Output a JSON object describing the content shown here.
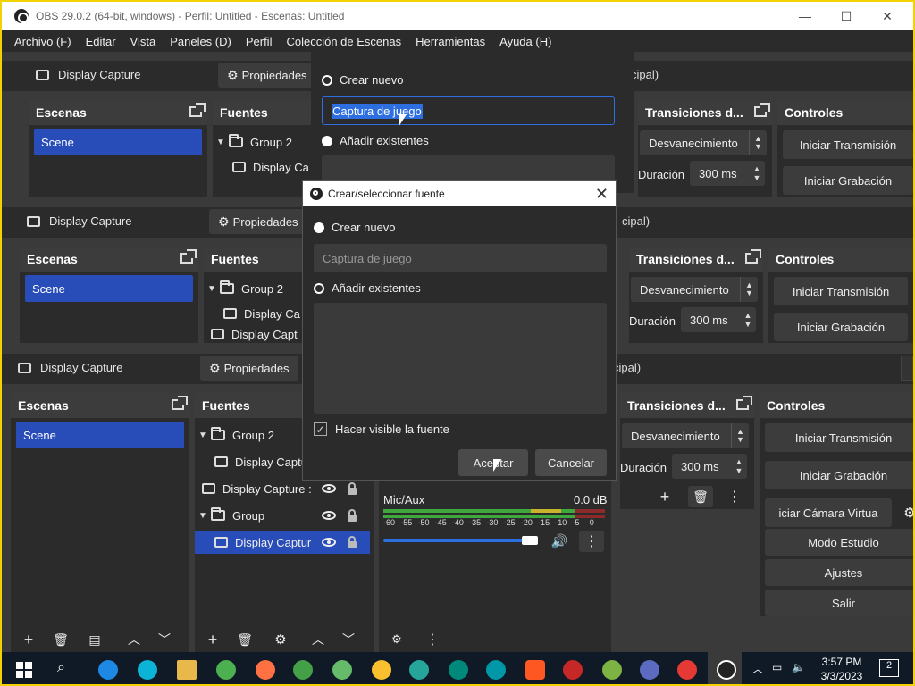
{
  "window": {
    "title": "OBS 29.0.2 (64-bit, windows) - Perfil: Untitled - Escenas: Untitled",
    "minimize": "—",
    "maximize": "☐",
    "close": "✕"
  },
  "menu": [
    "Archivo (F)",
    "Editar",
    "Vista",
    "Paneles (D)",
    "Perfil",
    "Colección de Escenas",
    "Herramientas",
    "Ayuda (H)"
  ],
  "properties_bar": {
    "source_label": "Display Capture",
    "properties_button": "Propiedades",
    "audio_label_fragment": "cipal)"
  },
  "docks": {
    "scenes_title": "Escenas",
    "sources_title": "Fuentes",
    "transitions_title": "Transiciones d...",
    "controls_title": "Controles"
  },
  "scenes": [
    "Scene"
  ],
  "sources": {
    "group2": "Group 2",
    "display_capture_child": "Display Captu",
    "display_capture_root": "Display Capture :",
    "group": "Group",
    "display_capture_selected": "Display Captur",
    "ghost_group2": "Group 2",
    "ghost_display_ca": "Display Ca",
    "ghost_display_capt": "Display Capt"
  },
  "transitions": {
    "fade": "Desvanecimiento",
    "duration_label": "Duración",
    "duration_value": "300 ms"
  },
  "controls": {
    "start_streaming": "Iniciar Transmisión",
    "start_recording": "Iniciar Grabación",
    "virtual_camera": "iciar Cámara Virtua",
    "studio_mode": "Modo Estudio",
    "settings": "Ajustes",
    "exit": "Salir"
  },
  "mixer": {
    "channel": "Mic/Aux",
    "level": "0.0 dB",
    "ticks": [
      "-60",
      "-55",
      "-50",
      "-45",
      "-40",
      "-35",
      "-30",
      "-25",
      "-20",
      "-15",
      "-10",
      "-5",
      "0"
    ],
    "volume_fraction": 0.93
  },
  "back_dialog": {
    "radio_new": "Crear nuevo",
    "name_value": "Captura de juego",
    "radio_existing": "Añadir existentes"
  },
  "dialog": {
    "title": "Crear/seleccionar fuente",
    "radio_new": "Crear nuevo",
    "name_placeholder": "Captura de juego",
    "radio_existing": "Añadir existentes",
    "make_visible": "Hacer visible la fuente",
    "ok": "Aceptar",
    "cancel": "Cancelar"
  },
  "taskbar": {
    "time": "3:57 PM",
    "date": "3/3/2023",
    "notifications": "2"
  },
  "colors": {
    "accent": "#284cb8",
    "panel": "#2b2b2b",
    "header": "#3c3c3c",
    "border_highlight": "#f2d200"
  },
  "icons": [
    "obs-icon",
    "gear-icon",
    "plus-icon",
    "trash-icon",
    "filter-icon",
    "up-arrow-icon",
    "down-arrow-icon",
    "eye-icon",
    "lock-icon",
    "speaker-icon",
    "kebab-icon",
    "windows-start-icon",
    "search-icon"
  ]
}
